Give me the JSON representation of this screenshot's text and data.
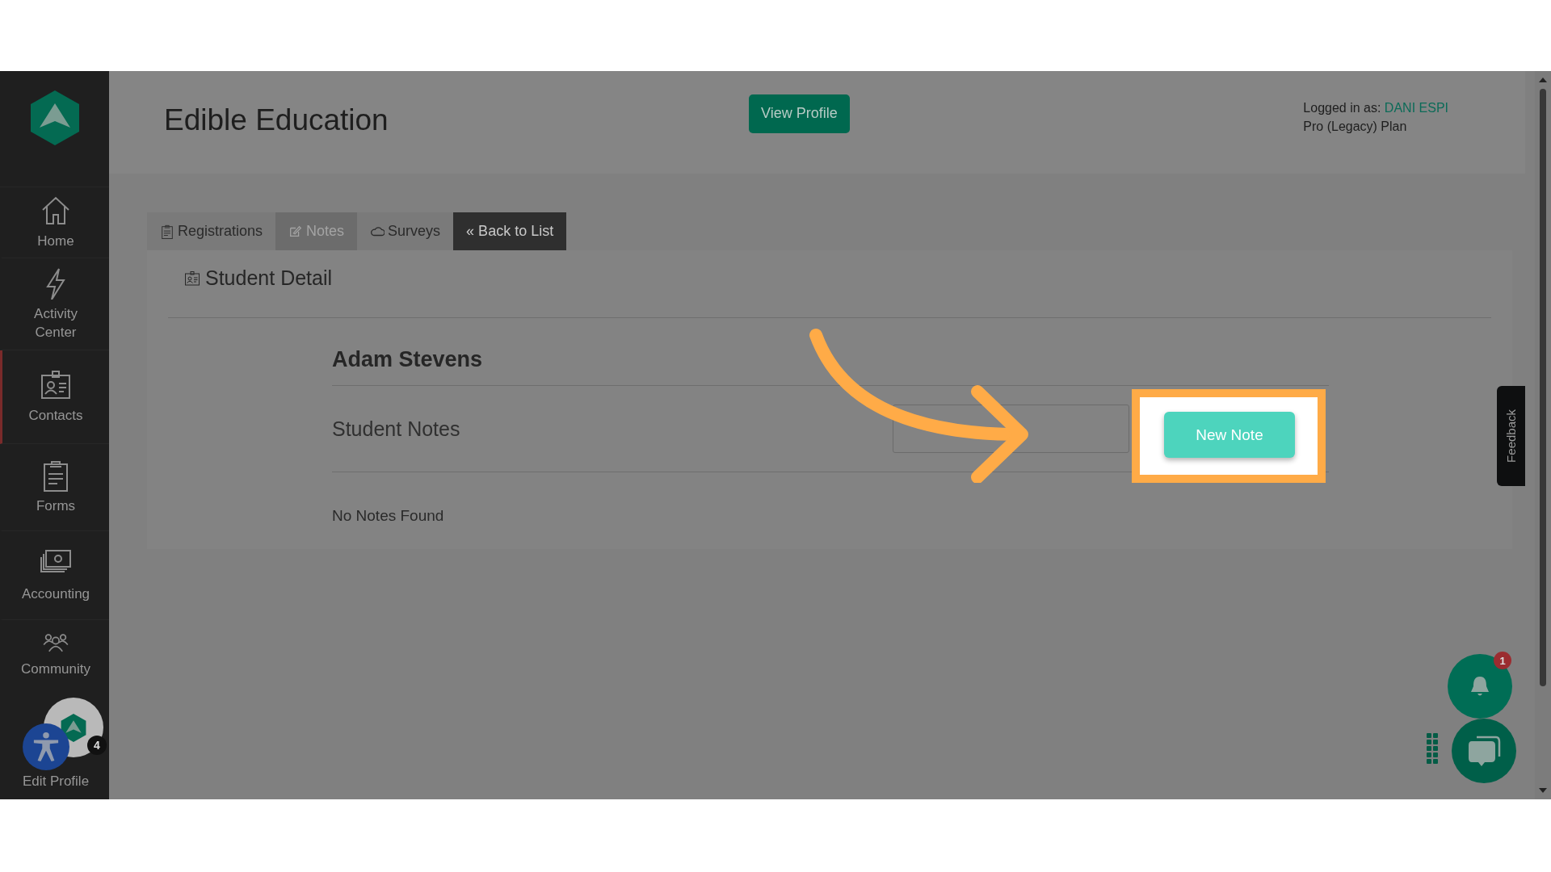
{
  "header": {
    "title": "Edible Education",
    "view_profile": "View Profile",
    "logged_in_label": "Logged in as:",
    "user": "DANI ESPI",
    "plan": "Pro (Legacy) Plan"
  },
  "sidebar": {
    "items": [
      {
        "label": "Home",
        "selected": false
      },
      {
        "label": "Activity Center",
        "selected": false
      },
      {
        "label": "Contacts",
        "selected": true
      },
      {
        "label": "Forms",
        "selected": false
      },
      {
        "label": "Accounting",
        "selected": false
      },
      {
        "label": "Community",
        "selected": false
      },
      {
        "label": "Edit Profile",
        "selected": false
      }
    ]
  },
  "tabs": [
    {
      "kind": "tab",
      "label": "Registrations",
      "selected": false
    },
    {
      "kind": "tab",
      "label": "Notes",
      "selected": true
    },
    {
      "kind": "tab",
      "label": "Surveys",
      "selected": false
    },
    {
      "kind": "link",
      "label": "« Back to List"
    }
  ],
  "panel": {
    "title": "Student Detail",
    "student_name": "Adam Stevens",
    "notes_heading": "Student Notes",
    "new_note_button": "New Note",
    "empty_message": "No Notes Found"
  },
  "feedback": "Feedback",
  "floating": {
    "avatar_badge": "4",
    "notifications_badge": "1"
  }
}
